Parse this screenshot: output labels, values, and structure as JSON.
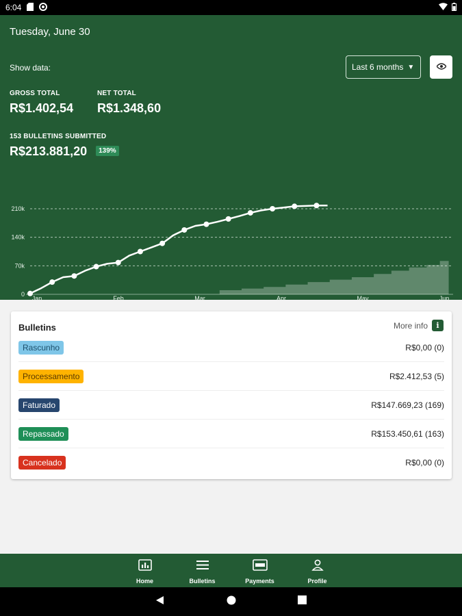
{
  "status_bar": {
    "time": "6:04"
  },
  "header": {
    "date": "Tuesday, June 30",
    "show_data_label": "Show data:",
    "period_selected": "Last 6 months",
    "gross_label": "GROSS TOTAL",
    "gross_value": "R$1.402,54",
    "net_label": "NET TOTAL",
    "net_value": "R$1.348,60",
    "bulletins_label": "153 BULLETINS SUBMITTED",
    "bulletins_value": "R$213.881,20",
    "bulletins_badge": "139%"
  },
  "chart_data": {
    "type": "line",
    "x_tick_labels": [
      "Jan",
      "Feb",
      "Mar",
      "Apr",
      "May",
      "Jun"
    ],
    "y_tick_labels": [
      "0",
      "70k",
      "140k",
      "210k"
    ],
    "ylim": [
      0,
      210000
    ],
    "grid": "dashed horizontal",
    "series": [
      {
        "values": [
          [
            0.0,
            2000
          ],
          [
            0.25,
            15000
          ],
          [
            0.5,
            30000
          ],
          [
            0.75,
            42000
          ],
          [
            1.0,
            45000
          ],
          [
            1.25,
            58000
          ],
          [
            1.5,
            68000
          ],
          [
            1.75,
            75000
          ],
          [
            2.0,
            78000
          ],
          [
            2.25,
            95000
          ],
          [
            2.5,
            105000
          ],
          [
            2.75,
            115000
          ],
          [
            3.0,
            125000
          ],
          [
            3.25,
            145000
          ],
          [
            3.5,
            158000
          ],
          [
            3.75,
            168000
          ],
          [
            4.0,
            172000
          ],
          [
            4.25,
            178000
          ],
          [
            4.5,
            185000
          ],
          [
            4.75,
            192000
          ],
          [
            5.0,
            200000
          ],
          [
            5.25,
            206000
          ],
          [
            5.5,
            210000
          ],
          [
            5.75,
            213000
          ],
          [
            6.0,
            216000
          ],
          [
            6.25,
            217000
          ],
          [
            6.5,
            218000
          ],
          [
            6.75,
            218000
          ]
        ]
      },
      {
        "values": [
          [
            4.3,
            10000
          ],
          [
            4.8,
            14000
          ],
          [
            5.3,
            18000
          ],
          [
            5.8,
            24000
          ],
          [
            6.3,
            30000
          ],
          [
            6.8,
            36000
          ],
          [
            7.3,
            42000
          ],
          [
            7.8,
            50000
          ],
          [
            8.2,
            58000
          ],
          [
            8.6,
            66000
          ],
          [
            9.0,
            72000
          ],
          [
            9.3,
            82000
          ],
          [
            9.5,
            96000
          ]
        ]
      }
    ]
  },
  "bulletins": {
    "title": "Bulletins",
    "more_info": "More info",
    "items": [
      {
        "label": "Rascunho",
        "amount": "R$0,00 (0)",
        "bg": "#7fc6e8",
        "fg": "#1d4f6b"
      },
      {
        "label": "Processamento",
        "amount": "R$2.412,53 (5)",
        "bg": "#ffb300",
        "fg": "#5a3a00"
      },
      {
        "label": "Faturado",
        "amount": "R$147.669,23 (169)",
        "bg": "#27466e",
        "fg": "#ffffff"
      },
      {
        "label": "Repassado",
        "amount": "R$153.450,61 (163)",
        "bg": "#1f8f57",
        "fg": "#ffffff"
      },
      {
        "label": "Cancelado",
        "amount": "R$0,00 (0)",
        "bg": "#d8321e",
        "fg": "#ffffff"
      }
    ]
  },
  "bottom_nav": {
    "items": [
      {
        "label": "Home",
        "icon": "home-dashboard-icon"
      },
      {
        "label": "Bulletins",
        "icon": "list-icon"
      },
      {
        "label": "Payments",
        "icon": "payments-icon"
      },
      {
        "label": "Profile",
        "icon": "profile-icon"
      }
    ]
  }
}
